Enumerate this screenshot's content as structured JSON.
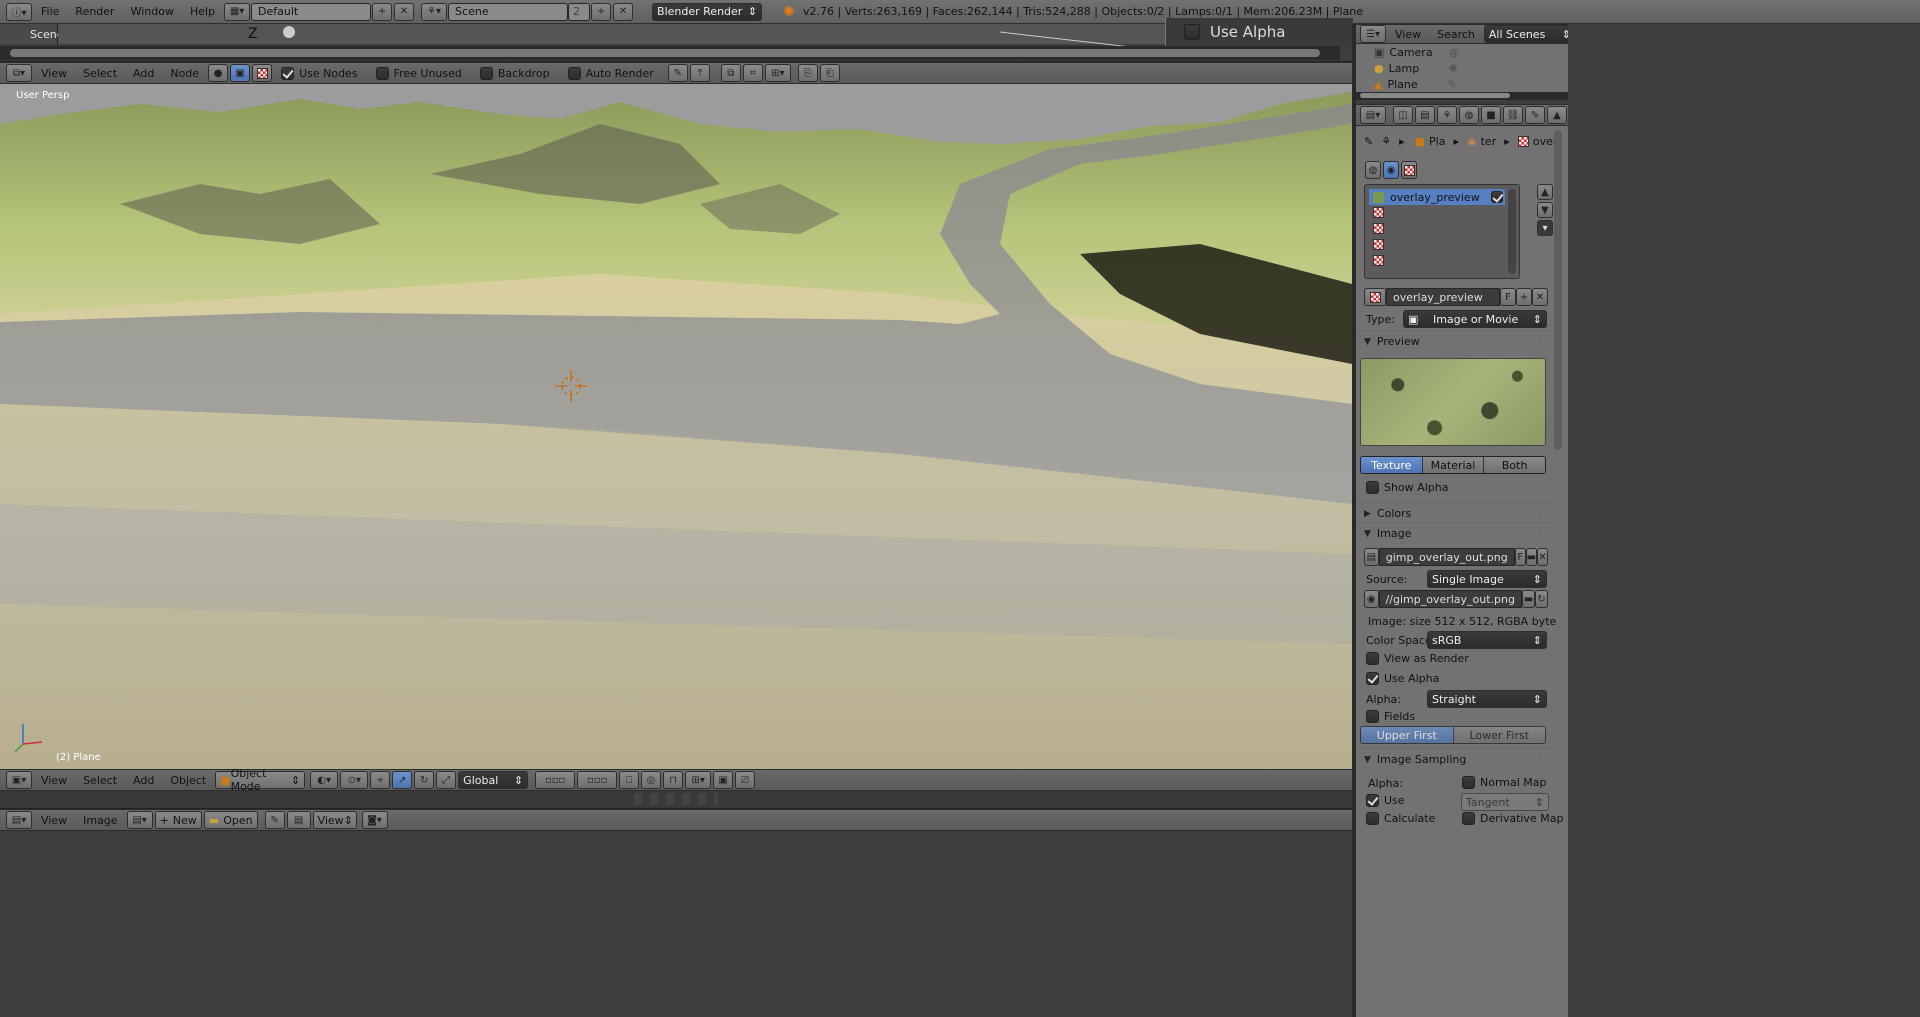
{
  "topbar": {
    "menus": [
      "File",
      "Render",
      "Window",
      "Help"
    ],
    "screen_layout": "Default",
    "scene": "Scene",
    "scene_users": "2",
    "render_engine": "Blender Render",
    "stats": "v2.76 | Verts:263,169 | Faces:262,144 | Tris:524,288 | Objects:0/2 | Lamps:0/1 | Mem:206.23M | Plane"
  },
  "timeline_strip": {
    "scene_label": "Scene",
    "axis_label": "Z",
    "overlay_text": "Use Alpha"
  },
  "node_header": {
    "menus": [
      "View",
      "Select",
      "Add",
      "Node"
    ],
    "use_nodes_label": "Use Nodes",
    "use_nodes": true,
    "free_unused_label": "Free Unused",
    "backdrop_label": "Backdrop",
    "auto_render_label": "Auto Render"
  },
  "viewport": {
    "view_label": "User Persp",
    "object_label": "(2) Plane"
  },
  "viewport_header": {
    "menus": [
      "View",
      "Select",
      "Add",
      "Object"
    ],
    "mode": "Object Mode",
    "orientation": "Global"
  },
  "image_editor_header": {
    "menus": [
      "View",
      "Image"
    ],
    "new_label": "New",
    "open_label": "Open",
    "view_label": "View"
  },
  "outliner": {
    "menus": [
      "View",
      "Search"
    ],
    "filter": "All Scenes",
    "items": [
      "Camera",
      "Lamp",
      "Plane"
    ]
  },
  "properties": {
    "breadcrumb": [
      "Pla",
      "ter",
      "overl"
    ],
    "texture_slots": [
      "overlay_preview",
      "",
      "",
      "",
      ""
    ],
    "texture_name": "overlay_preview",
    "fake_user": "F",
    "type_label": "Type:",
    "type_value": "Image or Movie",
    "preview_label": "Preview",
    "preview_tabs": [
      "Texture",
      "Material",
      "Both"
    ],
    "preview_tab_active": "Texture",
    "show_alpha_label": "Show Alpha",
    "colors_label": "Colors",
    "image_label": "Image",
    "image_name": "gimp_overlay_out.png",
    "source_label": "Source:",
    "source_value": "Single Image",
    "filepath": "//gimp_overlay_out.png",
    "image_info": "Image: size 512 x 512, RGBA byte",
    "colorspace_label": "Color Space:",
    "colorspace_value": "sRGB",
    "view_as_render_label": "View as Render",
    "use_alpha_label": "Use Alpha",
    "use_alpha": true,
    "alpha_label": "Alpha:",
    "alpha_value": "Straight",
    "fields_label": "Fields",
    "field_order": [
      "Upper First",
      "Lower First"
    ],
    "field_order_active": "Upper First",
    "sampling_label": "Image Sampling",
    "sampling_alpha_label": "Alpha:",
    "normal_map_label": "Normal Map",
    "use_label": "Use",
    "use_checked": true,
    "tangent_value": "Tangent",
    "calculate_label": "Calculate",
    "derivative_map_label": "Derivative Map"
  },
  "colors": {
    "accent": "#5680c2",
    "viewport_bg": "#9a9a9a",
    "panel_bg": "#727272"
  }
}
